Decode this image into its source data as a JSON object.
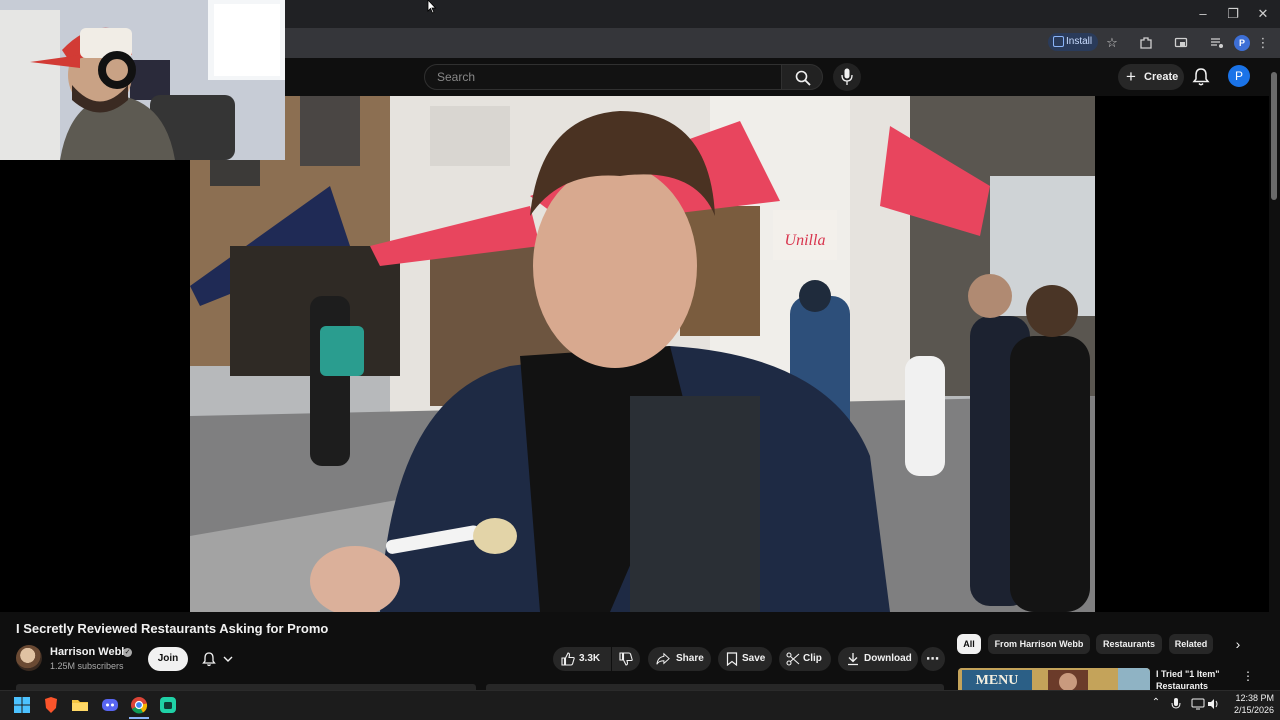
{
  "browser": {
    "install_label": "Install",
    "profile_initial": "P"
  },
  "youtube_header": {
    "search_placeholder": "Search",
    "create_label": "Create",
    "avatar_initial": "P"
  },
  "video": {
    "title": "I Secretly Reviewed Restaurants Asking for Promo",
    "channel_name": "Harrison Webb",
    "subscribers": "1.25M subscribers",
    "join_label": "Join",
    "like_count": "3.3K",
    "share_label": "Share",
    "save_label": "Save",
    "clip_label": "Clip",
    "download_label": "Download",
    "storefront_sign": "Unilla"
  },
  "chips": {
    "all": "All",
    "from_channel": "From Harrison Webb",
    "restaurants": "Restaurants",
    "related": "Related"
  },
  "recommendation": {
    "title": "I Tried \"1 Item\" Restaurants",
    "thumb_text": "MENU"
  },
  "taskbar": {
    "time": "12:38 PM",
    "date": "2/15/2026"
  },
  "colors": {
    "page_bg": "#0f0f0f",
    "pill_bg": "#272727",
    "avatar_blue": "#1a73e8",
    "awning_pink": "#e8455e",
    "awning_navy": "#1f2a55"
  }
}
